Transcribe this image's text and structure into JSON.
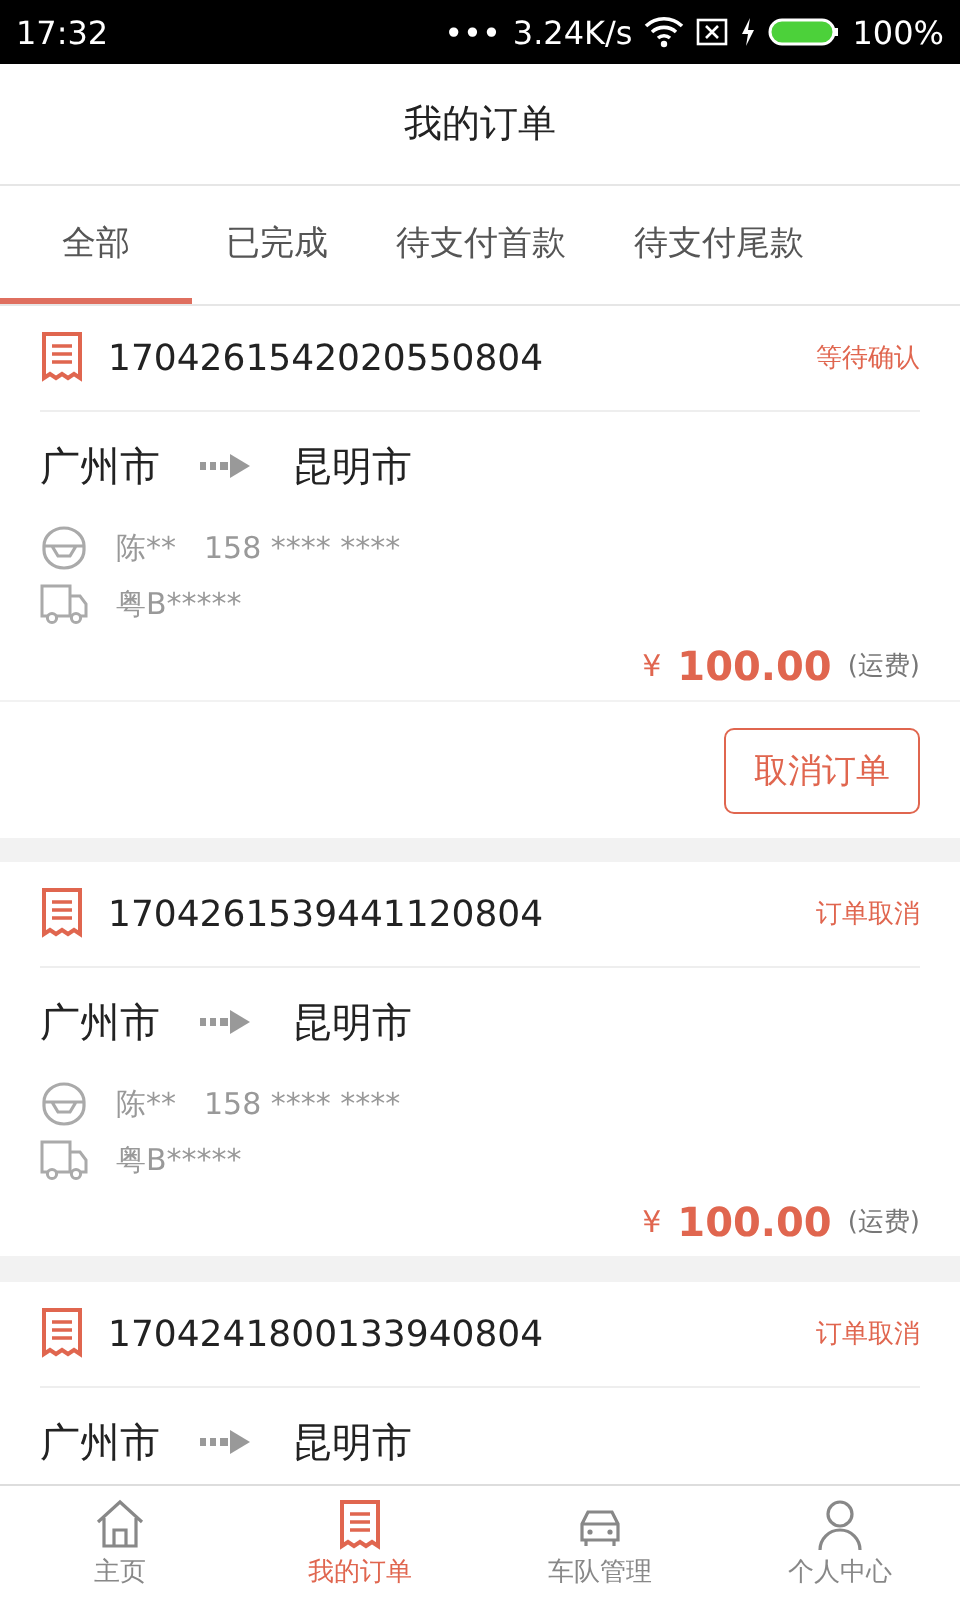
{
  "status_bar": {
    "time": "17:32",
    "dots": "•••",
    "speed": "3.24K/s",
    "battery": "100%"
  },
  "title": "我的订单",
  "tabs": [
    {
      "label": "全部",
      "selected": true
    },
    {
      "label": "已完成",
      "selected": false
    },
    {
      "label": "待支付首款",
      "selected": false
    },
    {
      "label": "待支付尾款",
      "selected": false
    }
  ],
  "orders": [
    {
      "number": "1704261542020550804",
      "status": "等待确认",
      "from": "广州市",
      "to": "昆明市",
      "driver": "陈**",
      "phone": "158 **** ****",
      "plate": "粤B*****",
      "currency": "¥",
      "price": "100.00",
      "price_note": "(运费)",
      "button": "取消订单"
    },
    {
      "number": "1704261539441120804",
      "status": "订单取消",
      "from": "广州市",
      "to": "昆明市",
      "driver": "陈**",
      "phone": "158 **** ****",
      "plate": "粤B*****",
      "currency": "¥",
      "price": "100.00",
      "price_note": "(运费)"
    },
    {
      "number": "1704241800133940804",
      "status": "订单取消",
      "from": "广州市",
      "to": "昆明市"
    }
  ],
  "nav": [
    {
      "label": "主页",
      "selected": false,
      "kind": "home"
    },
    {
      "label": "我的订单",
      "selected": true,
      "kind": "orders"
    },
    {
      "label": "车队管理",
      "selected": false,
      "kind": "fleet"
    },
    {
      "label": "个人中心",
      "selected": false,
      "kind": "person"
    }
  ]
}
